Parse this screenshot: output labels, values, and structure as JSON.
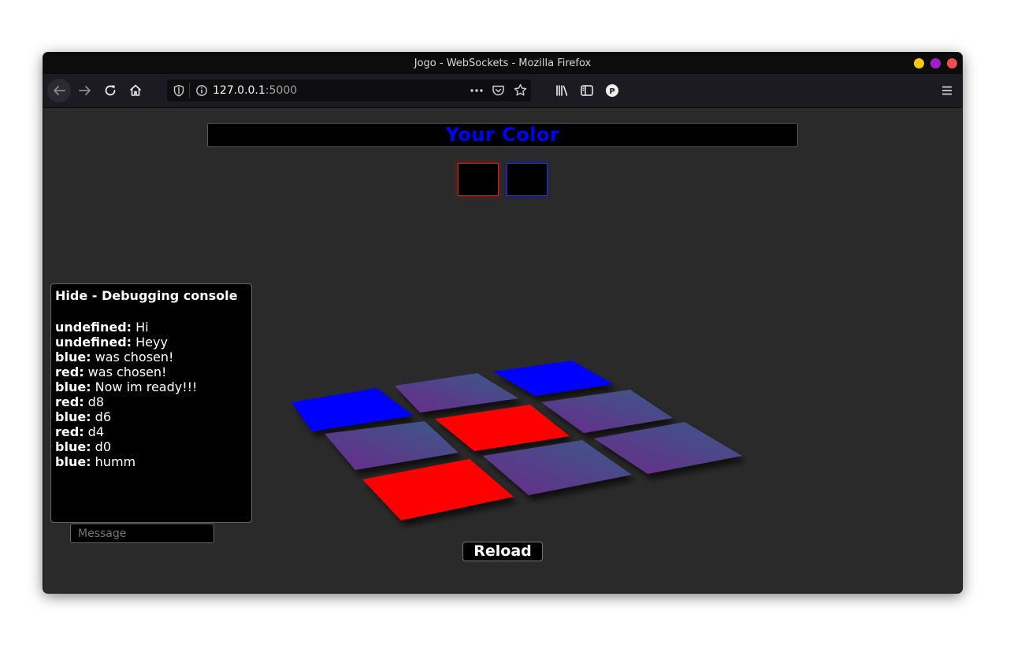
{
  "window": {
    "title": "Jogo - WebSockets - Mozilla Firefox",
    "controls": [
      {
        "name": "minimize",
        "color": "#f6c90e"
      },
      {
        "name": "maximize",
        "color": "#a020c8"
      },
      {
        "name": "close",
        "color": "#f24c4c"
      }
    ]
  },
  "browser": {
    "url_host": "127.0.0.1",
    "url_port": ":5000",
    "icons": [
      "back-arrow-icon",
      "forward-arrow-icon",
      "reload-icon",
      "home-icon",
      "shield-icon",
      "info-icon",
      "more-icon",
      "pocket-icon",
      "star-icon",
      "library-icon",
      "sidebar-icon",
      "profile-icon",
      "hamburger-menu-icon"
    ],
    "profile_letter": "P"
  },
  "page": {
    "your_color_label": "Your Color",
    "your_color_value": "#0000ff",
    "player_chips": [
      {
        "color": "red"
      },
      {
        "color": "blue"
      }
    ],
    "board": [
      [
        "blue",
        "empty",
        "blue"
      ],
      [
        "empty",
        "red",
        "empty"
      ],
      [
        "red",
        "empty",
        "empty"
      ]
    ],
    "colors": {
      "red": "#ff0000",
      "blue": "#0000ff",
      "empty_from": "#6a2a8a",
      "empty_to": "#3a5a88"
    },
    "console": {
      "header": "Hide - Debugging console",
      "messages": [
        {
          "sender": "undefined:",
          "text": " Hi"
        },
        {
          "sender": "undefined:",
          "text": " Heyy"
        },
        {
          "sender": "blue:",
          "text": " was chosen!"
        },
        {
          "sender": "red:",
          "text": " was chosen!"
        },
        {
          "sender": "blue:",
          "text": " Now im ready!!!"
        },
        {
          "sender": "red:",
          "text": " d8"
        },
        {
          "sender": "blue:",
          "text": " d6"
        },
        {
          "sender": "red:",
          "text": " d4"
        },
        {
          "sender": "blue:",
          "text": " d0"
        },
        {
          "sender": "blue:",
          "text": " humm"
        }
      ]
    },
    "message_placeholder": "Message",
    "reload_label": "Reload"
  }
}
